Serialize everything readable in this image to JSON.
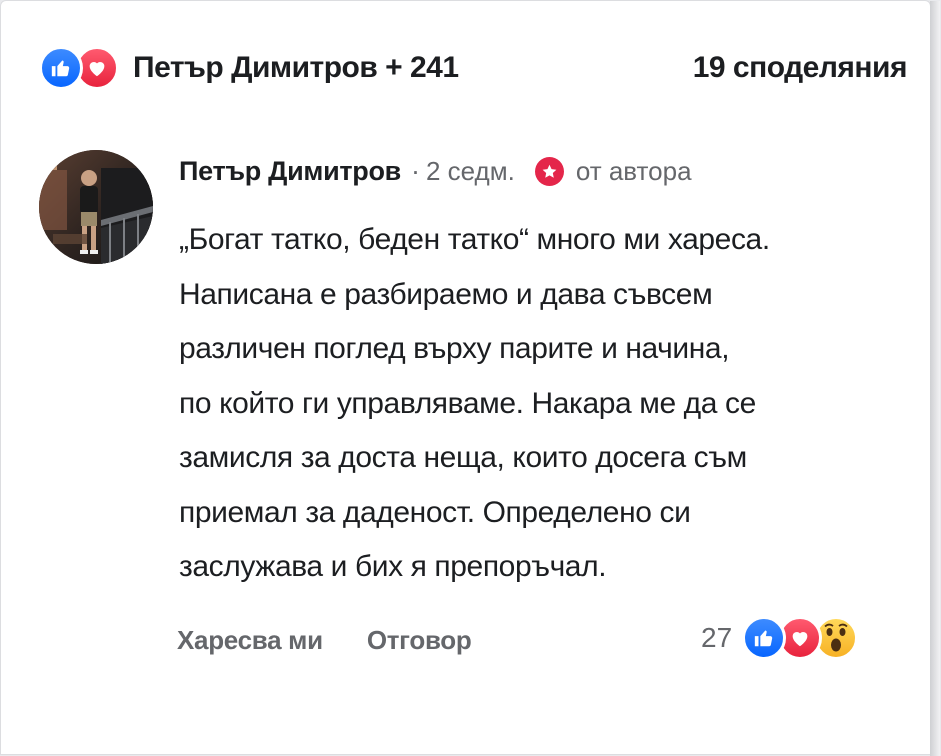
{
  "summary": {
    "names": "Петър Димитров + 241",
    "shares": "19 споделяния",
    "reactions": [
      "like-icon",
      "love-icon"
    ]
  },
  "comment": {
    "author": "Петър Димитров",
    "separator": "·",
    "time": "2 седм.",
    "badge": "от автора",
    "badge_icon": "star-icon",
    "lines": [
      "„Богат татко, беден татко“ много ми хареса.",
      "Написана е разбираемо и дава съвсем",
      "различен поглед върху парите и начина,",
      "по който ги управляваме. Накара ме да се",
      "замисля за доста неща, които досега съм",
      "приемал за даденост. Определено си",
      "заслужава и бих я препоръчал."
    ],
    "actions": {
      "like": "Харесва ми",
      "reply": "Отговор"
    },
    "reaction_count": "27",
    "reactions": [
      "like-icon",
      "love-icon",
      "wow-icon"
    ]
  },
  "colors": {
    "like": "#0866ff",
    "love": "#e8233d",
    "wow": "#f7b125",
    "text": "#1c1e21",
    "muted": "#65676b"
  }
}
